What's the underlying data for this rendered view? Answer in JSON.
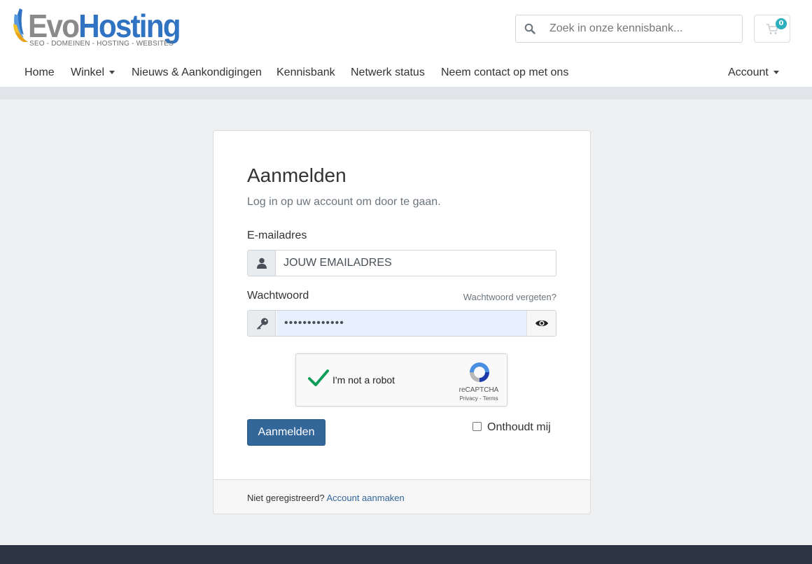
{
  "header": {
    "logo": {
      "part1": "Evo",
      "part2": "Hosting",
      "tagline": "SEO - DOMEINEN - HOSTING - WEBSITES"
    },
    "search": {
      "placeholder": "Zoek in onze kennisbank..."
    },
    "cart": {
      "count": "0"
    }
  },
  "nav": {
    "items": [
      {
        "label": "Home"
      },
      {
        "label": "Winkel"
      },
      {
        "label": "Nieuws & Aankondigingen"
      },
      {
        "label": "Kennisbank"
      },
      {
        "label": "Netwerk status"
      },
      {
        "label": "Neem contact op met ons"
      }
    ],
    "account": "Account"
  },
  "login": {
    "title": "Aanmelden",
    "subtitle": "Log in op uw account om door te gaan.",
    "email_label": "E-mailadres",
    "email_value": "JOUW EMAILADRES",
    "password_label": "Wachtwoord",
    "password_value": "•••••••••••••",
    "forgot": "Wachtwoord vergeten?",
    "captcha": {
      "label": "I'm not a robot",
      "brand": "reCAPTCHA",
      "links": "Privacy - Terms"
    },
    "submit": "Aanmelden",
    "remember": "Onthoudt mij",
    "footer_text": "Niet geregistreerd?",
    "footer_link": "Account aanmaken"
  },
  "colors": {
    "primary": "#336699",
    "logo_blue": "#2f73c2",
    "cart_badge": "#2fb0c0",
    "footer": "#2c3444"
  },
  "icons": [
    "search-icon",
    "cart-icon",
    "user-icon",
    "key-icon",
    "eye-icon",
    "checkmark-icon",
    "recaptcha-icon",
    "chevron-down-icon"
  ]
}
